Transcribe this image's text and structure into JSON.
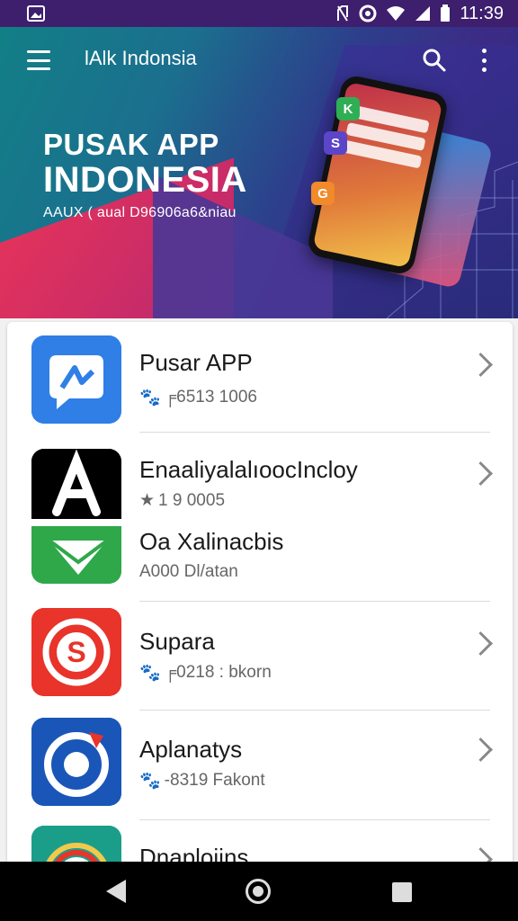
{
  "status_bar": {
    "time": "11:39",
    "icons": [
      "gallery-icon",
      "no-sim-icon",
      "data-saver-icon",
      "wifi-icon",
      "signal-icon",
      "battery-icon"
    ]
  },
  "toolbar": {
    "title": "lAlk Indonsia",
    "icons": [
      "menu-icon",
      "search-icon",
      "more-vert-icon"
    ]
  },
  "hero": {
    "title_line1": "PUSAK APP",
    "title_line2": "INDONESIA",
    "subtitle": "AAUX ( aual D96906a6&niau"
  },
  "apps": [
    {
      "title": "Pusar APP",
      "meta": "╒6513 1006",
      "meta_icon": "paw-icon",
      "icon": "chat-app-icon",
      "color": "#1f6fd8"
    },
    {
      "title": "EnaaliyalalıoocIncloy",
      "meta": "1 9 0005",
      "meta_icon": "star-icon",
      "icon": "letter-a-app-icon",
      "color": "#000000"
    },
    {
      "title": "Oa Xalinacbis",
      "meta": "A000 Dl/atan",
      "meta_icon": "",
      "icon": "send-app-icon",
      "color": "#2fa84a"
    },
    {
      "title": "Supara",
      "meta": "╒0218 : bkorn",
      "meta_icon": "paw-icon",
      "icon": "s-app-icon",
      "color": "#e8342a"
    },
    {
      "title": "Aplanatys",
      "meta": "-8319 Fakont",
      "meta_icon": "paw-icon",
      "icon": "sync-app-icon",
      "color": "#1a56b8"
    },
    {
      "title": "Dnaplojins",
      "meta": "",
      "meta_icon": "",
      "icon": "rainbow-app-icon",
      "color": "#1a9e8a"
    }
  ],
  "nav": {
    "icons": [
      "back-icon",
      "home-icon",
      "recents-icon"
    ]
  },
  "colors": {
    "status_bar": "#3d1f6e",
    "hero_start": "#127f86",
    "hero_end": "#2a2b7a",
    "accent_pink": "#e6335a",
    "card_bg": "#ffffff"
  }
}
